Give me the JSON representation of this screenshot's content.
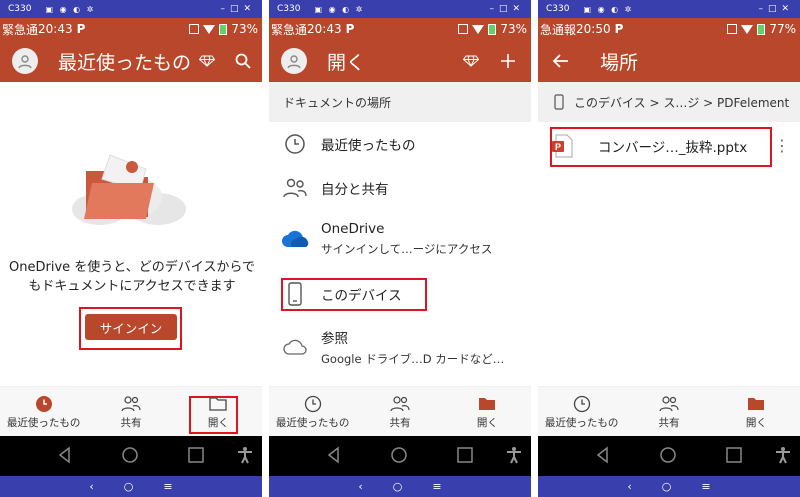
{
  "status": {
    "model": "C330",
    "time_a": "20:43",
    "time_b": "20:50",
    "notif_a": "緊急通",
    "notif_c": "急通報",
    "battery_a": "73%",
    "battery_b": "77%"
  },
  "screen1": {
    "title": "最近使ったもの",
    "message": "OneDrive を使うと、どのデバイスからでもドキュメントにアクセスできます",
    "signin_label": "サインイン"
  },
  "screen2": {
    "title": "開く",
    "section_header": "ドキュメントの場所",
    "items": [
      {
        "label": "最近使ったもの",
        "icon": "clock-icon"
      },
      {
        "label": "自分と共有",
        "icon": "people-icon"
      },
      {
        "label": "OneDrive",
        "sub": "サインインして…ージにアクセス",
        "icon": "cloud-icon"
      },
      {
        "label": "このデバイス",
        "icon": "phone-icon"
      },
      {
        "label": "参照",
        "sub": "Google ドライブ…D カードなど…",
        "icon": "cloud-outline-icon"
      }
    ]
  },
  "screen3": {
    "title": "場所",
    "breadcrumb": "このデバイス > ス…ジ > PDFelement",
    "file_name": "コンバージ…_抜粋.pptx"
  },
  "nav": {
    "recent": "最近使ったもの",
    "shared": "共有",
    "open": "開く"
  },
  "colors": {
    "accent": "#b8472b",
    "emulator_bar": "#3a3fae",
    "highlight": "#e0141e"
  }
}
